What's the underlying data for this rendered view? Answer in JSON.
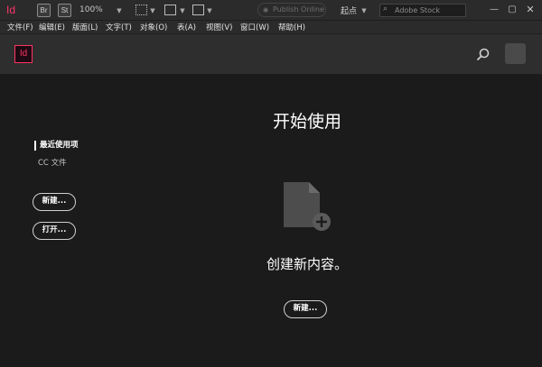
{
  "appbar": {
    "logo_text": "Id",
    "bridge_text": "Br",
    "stock_text": "St",
    "zoom": "100%",
    "publish_label": "Publish Online",
    "workspace": "起点",
    "stock_search_placeholder": "Adobe Stock"
  },
  "menu": [
    "文件(F)",
    "编辑(E)",
    "版面(L)",
    "文字(T)",
    "对象(O)",
    "表(A)",
    "视图(V)",
    "窗口(W)",
    "帮助(H)"
  ],
  "home": {
    "badge_text": "Id",
    "title": "开始使用",
    "sidebar": {
      "recent_label": "最近使用项",
      "cc_label": "CC 文件"
    },
    "new_button": "新建...",
    "open_button": "打开...",
    "create_text": "创建新内容。",
    "new_main_button": "新建..."
  },
  "colors": {
    "brand": "#ff3366",
    "background": "#1b1b1b",
    "header": "#2e2e2e",
    "appbar": "#2b2b2b"
  },
  "icons": [
    "search-icon",
    "document-add-icon",
    "minimize-icon",
    "maximize-icon",
    "close-icon"
  ]
}
